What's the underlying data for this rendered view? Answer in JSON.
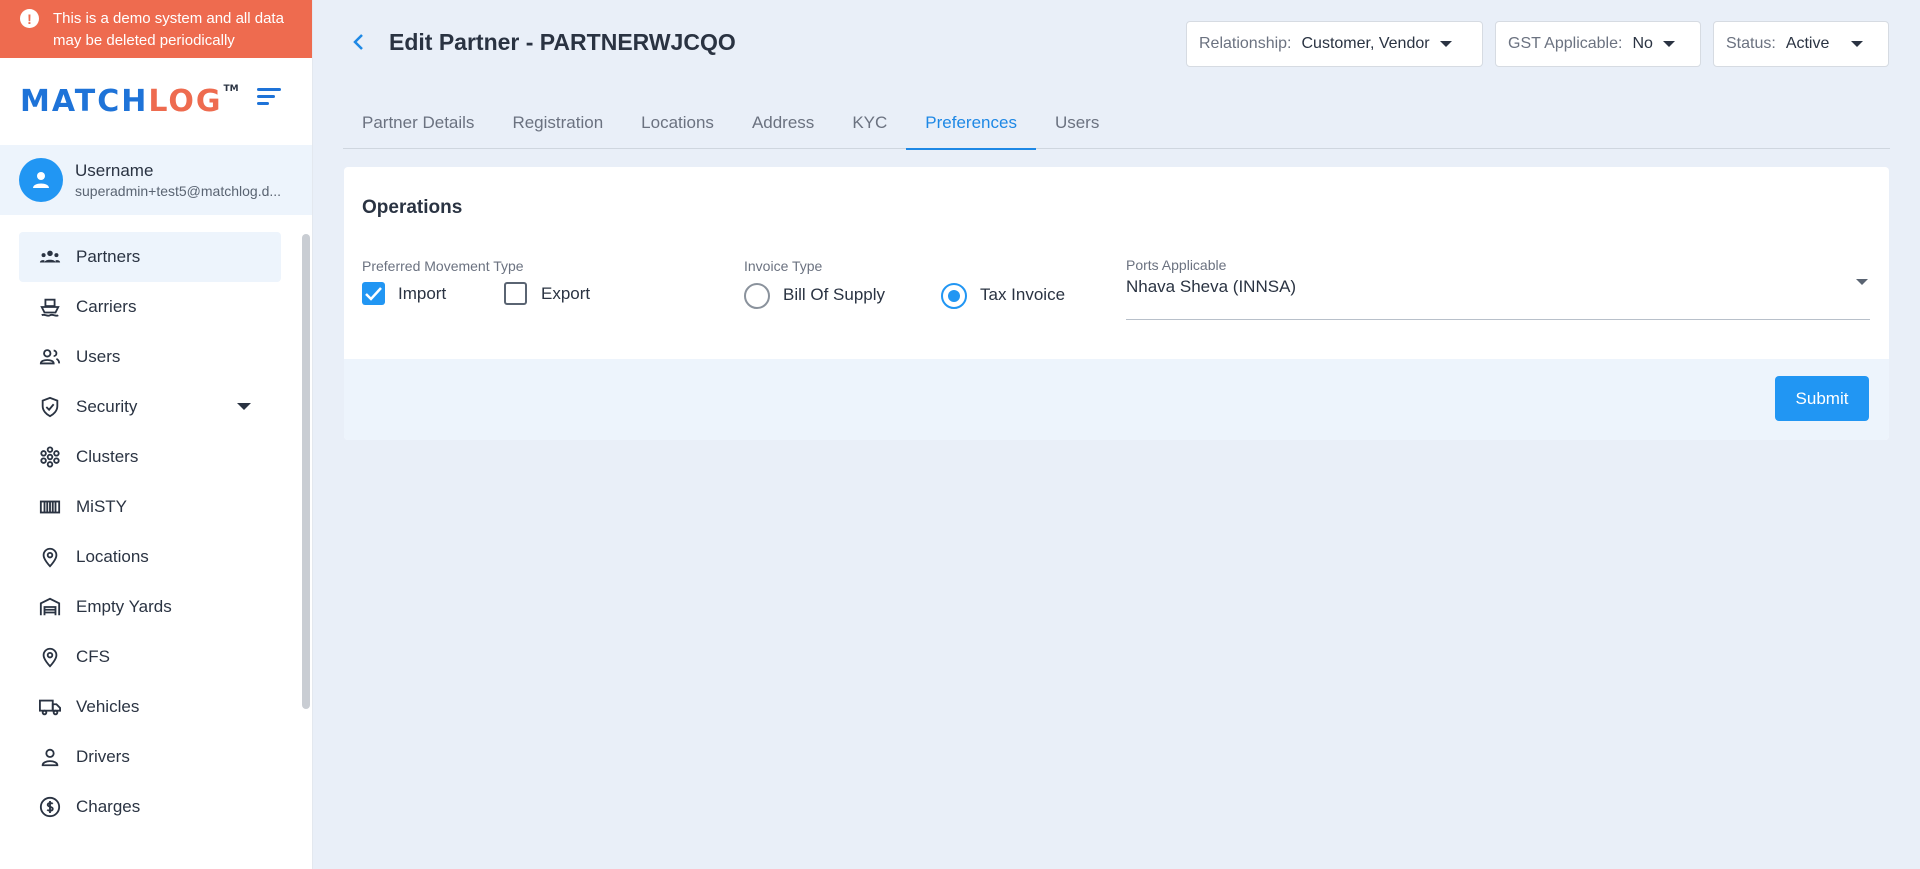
{
  "banner": {
    "text": "This is a demo system and all data may be deleted periodically",
    "icon": "alert-circle-icon"
  },
  "logo": {
    "part1": "MATCH",
    "part2": "LOG",
    "tm": "TM"
  },
  "user": {
    "name": "Username",
    "email": "superadmin+test5@matchlog.d..."
  },
  "sidebar": {
    "items": [
      {
        "label": "Partners",
        "icon": "partners-icon",
        "active": true
      },
      {
        "label": "Carriers",
        "icon": "ship-icon"
      },
      {
        "label": "Users",
        "icon": "users-icon"
      },
      {
        "label": "Security",
        "icon": "shield-icon",
        "expandable": true
      },
      {
        "label": "Clusters",
        "icon": "cluster-icon"
      },
      {
        "label": "MiSTY",
        "icon": "container-icon"
      },
      {
        "label": "Locations",
        "icon": "location-pin-icon"
      },
      {
        "label": "Empty Yards",
        "icon": "warehouse-icon"
      },
      {
        "label": "CFS",
        "icon": "location-pin-icon"
      },
      {
        "label": "Vehicles",
        "icon": "truck-icon"
      },
      {
        "label": "Drivers",
        "icon": "person-icon"
      },
      {
        "label": "Charges",
        "icon": "dollar-icon"
      }
    ]
  },
  "header": {
    "title": "Edit Partner - PARTNERWJCQO",
    "relationship": {
      "label": "Relationship:",
      "value": "Customer, Vendor"
    },
    "gst": {
      "label": "GST Applicable:",
      "value": "No"
    },
    "status": {
      "label": "Status:",
      "value": "Active"
    }
  },
  "tabs": [
    {
      "label": "Partner Details"
    },
    {
      "label": "Registration"
    },
    {
      "label": "Locations"
    },
    {
      "label": "Address"
    },
    {
      "label": "KYC"
    },
    {
      "label": "Preferences",
      "active": true
    },
    {
      "label": "Users"
    }
  ],
  "operations": {
    "title": "Operations",
    "movement": {
      "label": "Preferred Movement Type",
      "import": "Import",
      "export": "Export",
      "import_checked": true,
      "export_checked": false
    },
    "invoice": {
      "label": "Invoice Type",
      "bill": "Bill Of Supply",
      "tax": "Tax Invoice",
      "selected": "Tax Invoice"
    },
    "ports": {
      "label": "Ports Applicable",
      "value": "Nhava Sheva (INNSA)"
    },
    "submit_label": "Submit"
  },
  "colors": {
    "accent": "#2196f3",
    "banner": "#ee6b4f",
    "brand_blue": "#1e73d8",
    "brand_orange": "#ee6b4f"
  }
}
